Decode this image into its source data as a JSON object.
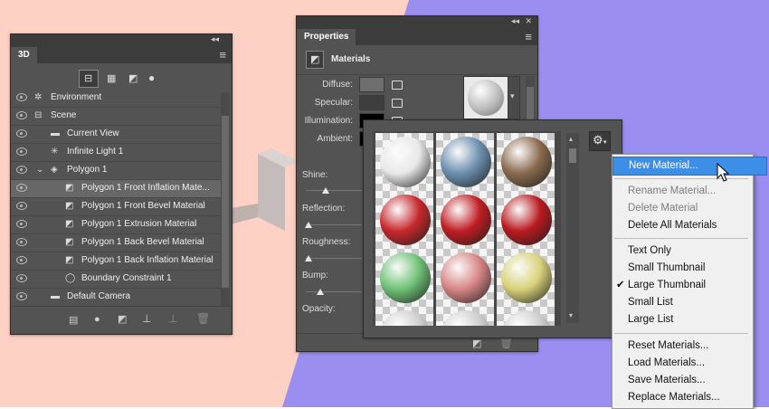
{
  "panel3d": {
    "tab": "3D",
    "collapse_glyph": "◂◂",
    "close_glyph": "✕",
    "menu_glyph": "≡",
    "rows": [
      {
        "label": "Environment",
        "icon": "environment-icon",
        "glyph": "✲"
      },
      {
        "label": "Scene",
        "icon": "scene-icon",
        "glyph": "⊟"
      },
      {
        "label": "Current View",
        "icon": "camera-icon",
        "glyph": "▬"
      },
      {
        "label": "Infinite Light 1",
        "icon": "light-icon",
        "glyph": "✳"
      },
      {
        "label": "Polygon 1",
        "icon": "mesh-icon",
        "glyph": "◈"
      },
      {
        "label": "Polygon 1 Front Inflation Mate...",
        "icon": "material-icon",
        "glyph": "◩"
      },
      {
        "label": "Polygon 1 Front Bevel Material",
        "icon": "material-icon",
        "glyph": "◩"
      },
      {
        "label": "Polygon 1 Extrusion Material",
        "icon": "material-icon",
        "glyph": "◩"
      },
      {
        "label": "Polygon 1 Back Bevel Material",
        "icon": "material-icon",
        "glyph": "◩"
      },
      {
        "label": "Polygon 1 Back Inflation Material",
        "icon": "material-icon",
        "glyph": "◩"
      },
      {
        "label": "Boundary Constraint 1",
        "icon": "constraint-icon",
        "glyph": "◯"
      },
      {
        "label": "Default Camera",
        "icon": "camera-icon",
        "glyph": "▬"
      }
    ],
    "selected_row": "Polygon 1 Front Inflation Mate..."
  },
  "properties": {
    "tab": "Properties",
    "section_title": "Materials",
    "labels": {
      "diffuse": "Diffuse:",
      "specular": "Specular:",
      "illumination": "Illumination:",
      "ambient": "Ambient:",
      "shine": "Shine:",
      "reflection": "Reflection:",
      "roughness": "Roughness:",
      "bump": "Bump:",
      "opacity": "Opacity:"
    },
    "slider_levels": {
      "shine": 0.35,
      "reflection": 0.05,
      "roughness": 0.05,
      "bump": 0.25
    },
    "colors": {
      "diffuse": "#6e6e6e",
      "specular": "#3e3e3e",
      "illumination": "#000000",
      "ambient": "#000000"
    }
  },
  "picker": {
    "gear_glyph": "⚙",
    "materials": [
      {
        "name": "white-marble",
        "color": "#e9e9e9"
      },
      {
        "name": "blue-stone",
        "color": "#6d8fae"
      },
      {
        "name": "brown-wood",
        "color": "#8a6a4e"
      },
      {
        "name": "red-knit",
        "color": "#c7282c"
      },
      {
        "name": "red-glossy-knit",
        "color": "#c01d22"
      },
      {
        "name": "red-plaid",
        "color": "#b81a1f"
      },
      {
        "name": "green-glass",
        "color": "#6fc276"
      },
      {
        "name": "pink-glass",
        "color": "#d88686"
      },
      {
        "name": "yellow-glass",
        "color": "#d9d27a"
      }
    ]
  },
  "menu": {
    "groups": [
      [
        {
          "label": "New Material...",
          "state": "selected"
        }
      ],
      [
        {
          "label": "Rename Material...",
          "state": "disabled"
        },
        {
          "label": "Delete Material",
          "state": "disabled"
        },
        {
          "label": "Delete All Materials",
          "state": "enabled"
        }
      ],
      [
        {
          "label": "Text Only",
          "state": "enabled"
        },
        {
          "label": "Small Thumbnail",
          "state": "enabled"
        },
        {
          "label": "Large Thumbnail",
          "state": "checked"
        },
        {
          "label": "Small List",
          "state": "enabled"
        },
        {
          "label": "Large List",
          "state": "enabled"
        }
      ],
      [
        {
          "label": "Reset Materials...",
          "state": "enabled"
        },
        {
          "label": "Load Materials...",
          "state": "enabled"
        },
        {
          "label": "Save Materials...",
          "state": "enabled"
        },
        {
          "label": "Replace Materials...",
          "state": "enabled"
        }
      ]
    ],
    "check_glyph": "✔"
  },
  "colors": {
    "background_left": "#ffd1c4",
    "background_right": "#9a8ff0",
    "panel": "#535353",
    "menu_highlight": "#3d8ee6"
  }
}
